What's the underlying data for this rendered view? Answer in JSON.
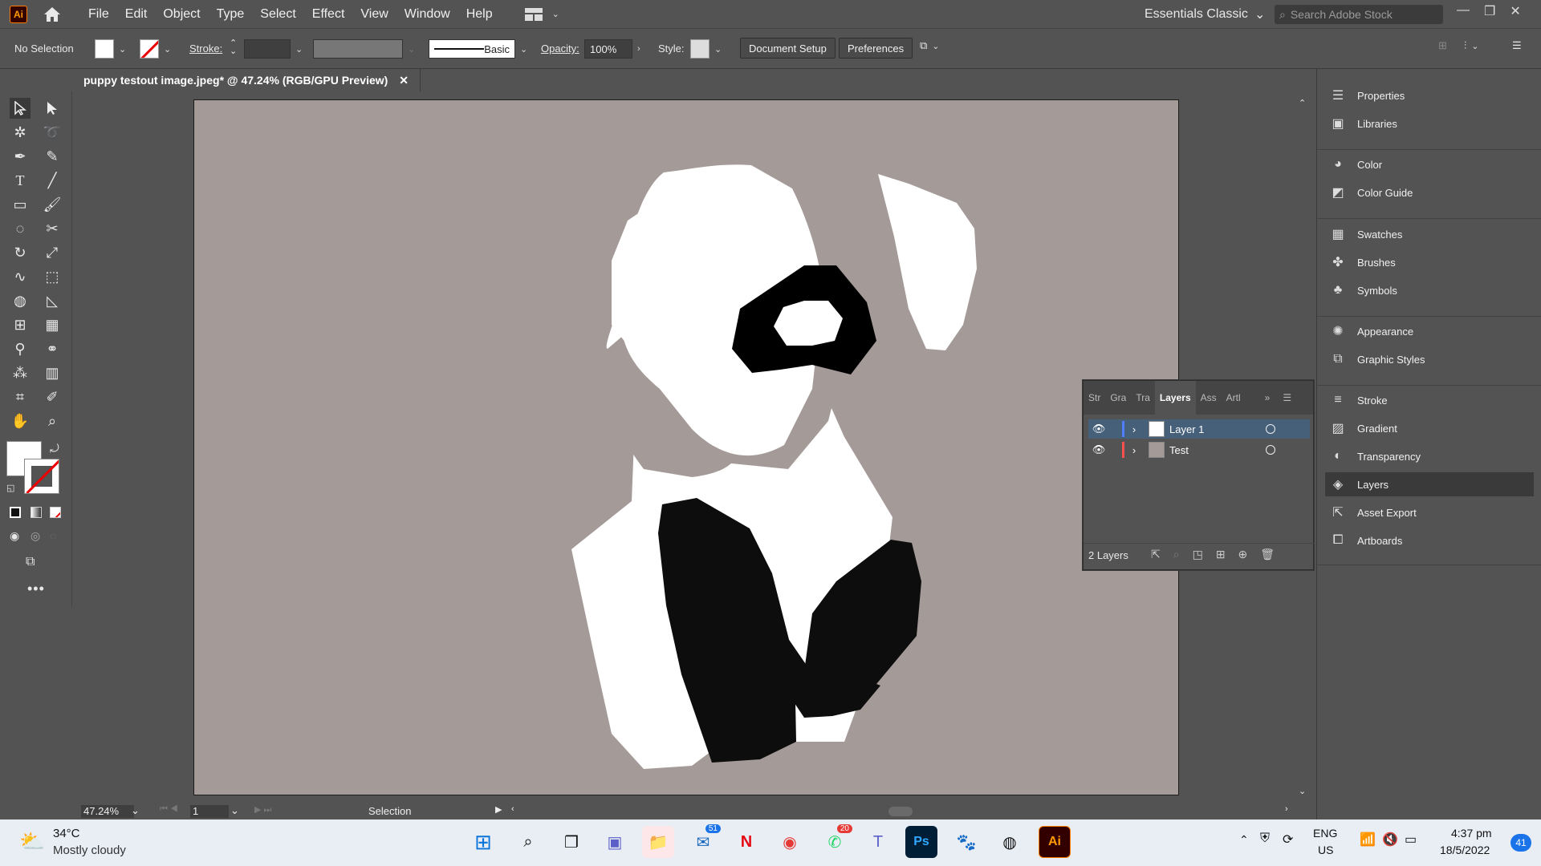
{
  "menubar": {
    "logo": "Ai",
    "items": [
      "File",
      "Edit",
      "Object",
      "Type",
      "Select",
      "Effect",
      "View",
      "Window",
      "Help"
    ],
    "workspace": "Essentials Classic",
    "search_placeholder": "Search Adobe Stock"
  },
  "controlbar": {
    "selection_status": "No Selection",
    "stroke_label": "Stroke:",
    "brush_label": "Basic",
    "opacity_label": "Opacity:",
    "opacity_value": "100%",
    "style_label": "Style:",
    "document_setup": "Document Setup",
    "preferences": "Preferences"
  },
  "document": {
    "tab_title": "puppy testout image.jpeg* @ 47.24% (RGB/GPU Preview)",
    "close_glyph": "✕"
  },
  "statusbar": {
    "zoom": "47.24%",
    "artboard_number": "1",
    "tool_status": "Selection"
  },
  "right_panel": {
    "groups": [
      [
        "Properties",
        "Libraries"
      ],
      [
        "Color",
        "Color Guide"
      ],
      [
        "Swatches",
        "Brushes",
        "Symbols"
      ],
      [
        "Appearance",
        "Graphic Styles"
      ],
      [
        "Stroke",
        "Gradient",
        "Transparency",
        "Layers",
        "Asset Export",
        "Artboards"
      ]
    ],
    "active": "Layers"
  },
  "layers_panel": {
    "tabs": [
      "Str",
      "Gra",
      "Tra",
      "Layers",
      "Ass",
      "Artl"
    ],
    "active_tab": "Layers",
    "layers": [
      {
        "name": "Layer 1",
        "color": "#4f7fff",
        "selected": true
      },
      {
        "name": "Test",
        "color": "#ff4f4f",
        "selected": false
      }
    ],
    "count_label": "2 Layers"
  },
  "taskbar": {
    "weather_temp": "34°C",
    "weather_desc": "Mostly cloudy",
    "language": "ENG",
    "region": "US",
    "time": "4:37 pm",
    "date": "18/5/2022",
    "notification_count": "41",
    "mail_badge": "51",
    "whatsapp_badge": "20"
  },
  "colors": {
    "artboard_bg": "#a49a98",
    "ui_bg": "#535353",
    "accent_orange": "#ff9a00"
  }
}
